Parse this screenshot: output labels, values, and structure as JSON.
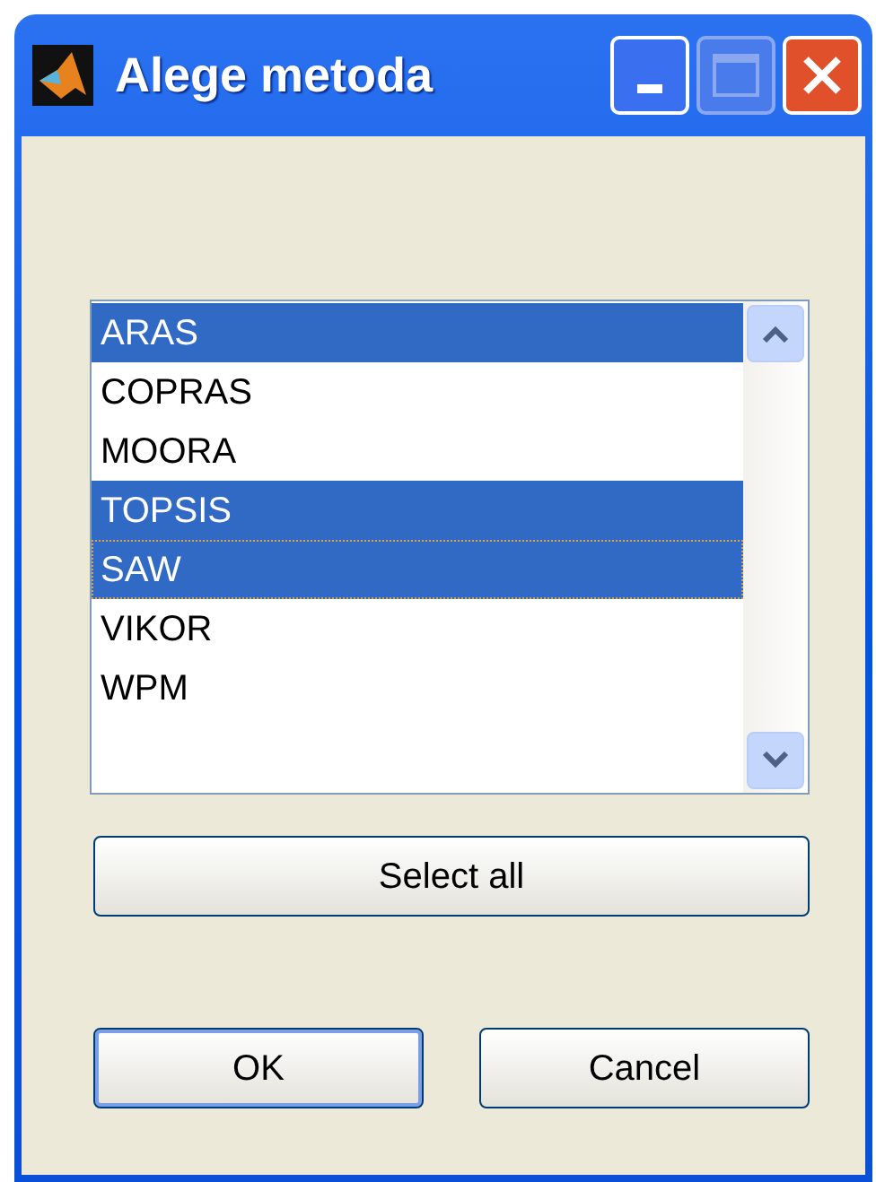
{
  "window": {
    "title": "Alege metoda"
  },
  "list": {
    "items": [
      {
        "label": "ARAS",
        "selected": true,
        "focused": false
      },
      {
        "label": "COPRAS",
        "selected": false,
        "focused": false
      },
      {
        "label": "MOORA",
        "selected": false,
        "focused": false
      },
      {
        "label": "TOPSIS",
        "selected": true,
        "focused": false
      },
      {
        "label": "SAW",
        "selected": true,
        "focused": true
      },
      {
        "label": "VIKOR",
        "selected": false,
        "focused": false
      },
      {
        "label": "WPM",
        "selected": false,
        "focused": false
      }
    ]
  },
  "select_all_button": "Select all",
  "buttons": [
    "OK",
    "Cancel"
  ]
}
